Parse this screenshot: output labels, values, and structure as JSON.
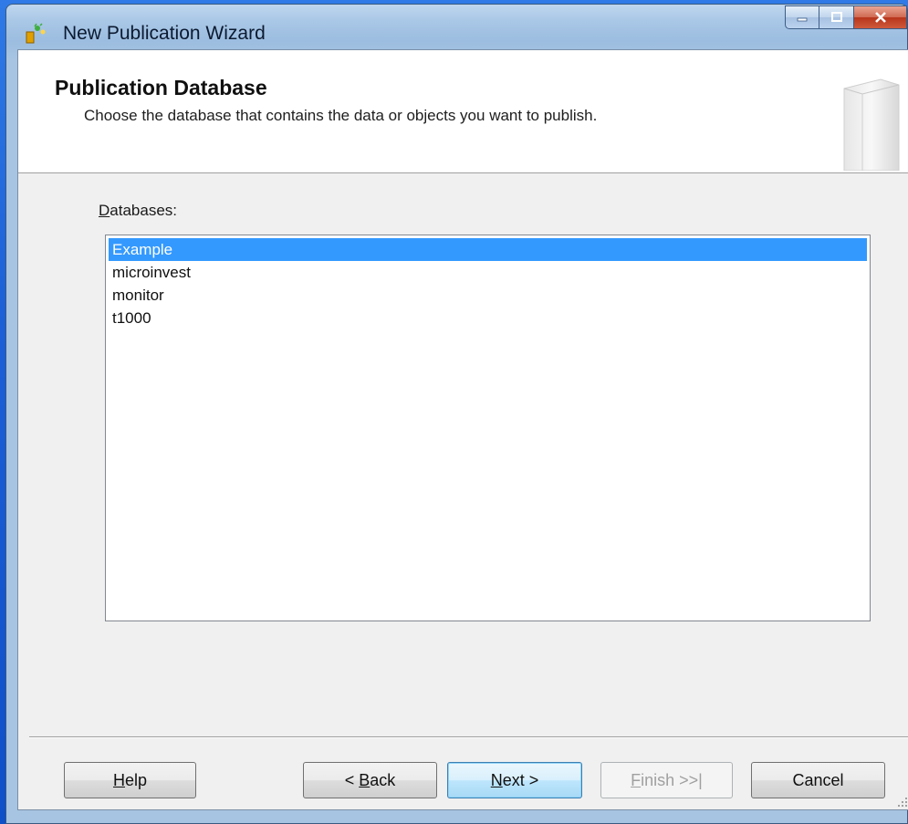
{
  "window": {
    "title": "New Publication Wizard",
    "icon": "wizard-app-icon"
  },
  "header": {
    "title": "Publication Database",
    "subtitle": "Choose the database that contains the data or objects you want to publish."
  },
  "databases": {
    "label_prefix": "D",
    "label_rest": "atabases:",
    "items": [
      {
        "label": "Example",
        "selected": true
      },
      {
        "label": "microinvest",
        "selected": false
      },
      {
        "label": "monitor",
        "selected": false
      },
      {
        "label": "t1000",
        "selected": false
      }
    ]
  },
  "buttons": {
    "help_mn": "H",
    "help_rest": "elp",
    "back_pre": "< ",
    "back_mn": "B",
    "back_rest": "ack",
    "next_mn": "N",
    "next_rest": "ext >",
    "finish_mn": "F",
    "finish_rest": "inish >>|",
    "cancel": "Cancel"
  },
  "colors": {
    "selection": "#3399ff",
    "desktop": "#1c5fd6",
    "close_button": "#c8462a"
  }
}
